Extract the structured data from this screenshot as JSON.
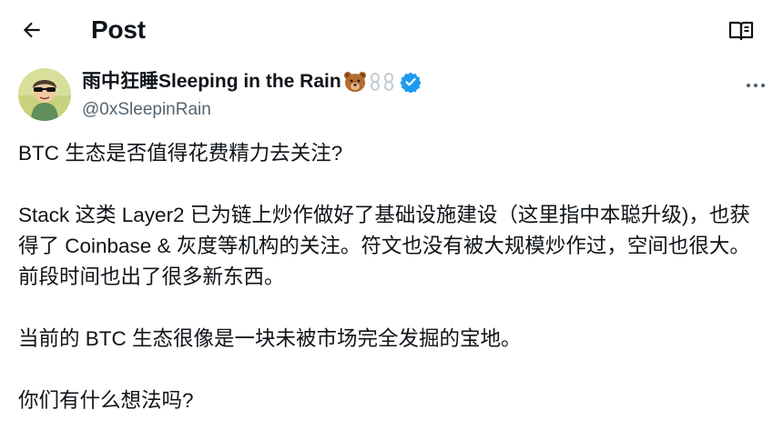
{
  "header": {
    "title": "Post",
    "back_icon": "arrow-left-icon",
    "reader_icon": "open-book-icon"
  },
  "author": {
    "display_name": "雨中狂睡Sleeping in the Rain",
    "name_emojis": [
      "bear-face-emoji",
      "chain-link-emoji"
    ],
    "verified_badge": "verified-badge-icon",
    "verified_color": "#1d9bf0",
    "handle": "@0xSleepinRain",
    "more_icon": "more-horizontal-icon"
  },
  "post": {
    "paragraphs": [
      "BTC 生态是否值得花费精力去关注?",
      "Stack 这类 Layer2 已为链上炒作做好了基础设施建设（这里指中本聪升级)，也获得了 Coinbase & 灰度等机构的关注。符文也没有被大规模炒作过，空间也很大。前段时间也出了很多新东西。",
      "当前的 BTC 生态很像是一块未被市场完全发掘的宝地。",
      "你们有什么想法吗?"
    ]
  },
  "colors": {
    "text": "#0f1419",
    "secondary": "#536471",
    "accent": "#1d9bf0"
  }
}
